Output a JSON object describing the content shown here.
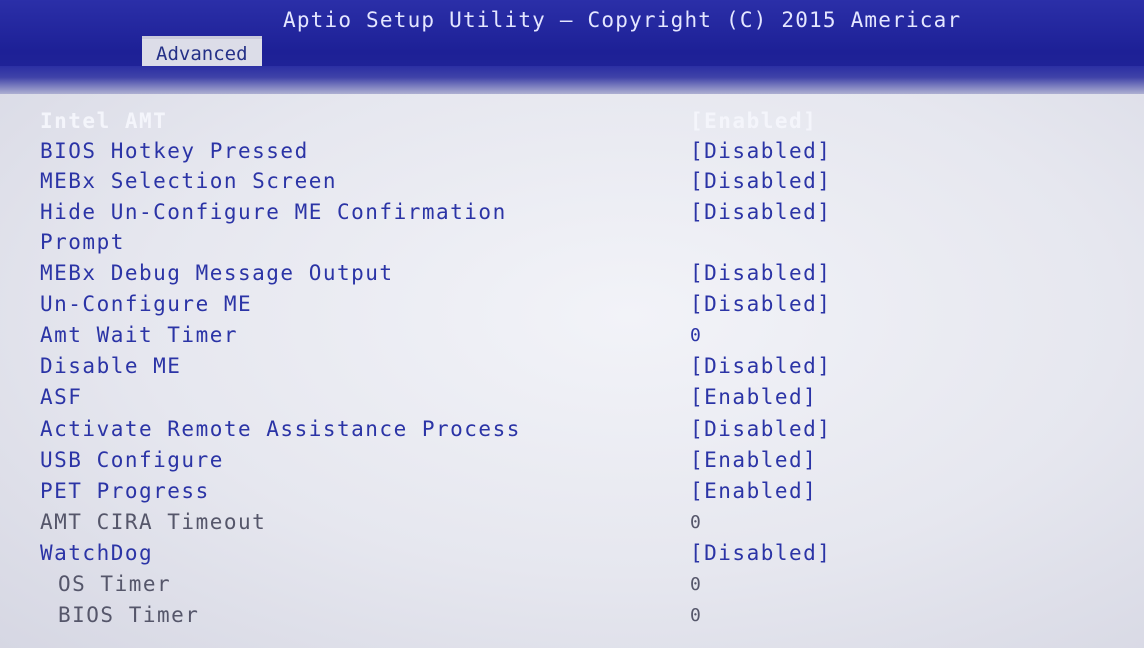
{
  "header": {
    "title": "Aptio Setup Utility – Copyright (C) 2015 Americar",
    "tab": "Advanced"
  },
  "colors": {
    "header_bg": "#1d2096",
    "panel_bg": "#e6e7ef",
    "active_text": "#2b34a6",
    "selected_text": "#f4f5fb",
    "inactive_text": "#55566a"
  },
  "settings": [
    {
      "label": "Intel AMT",
      "value": "[Enabled]"
    },
    {
      "label": "BIOS Hotkey Pressed",
      "value": "[Disabled]"
    },
    {
      "label": "MEBx Selection Screen",
      "value": "[Disabled]"
    },
    {
      "label": "Hide Un-Configure ME Confirmation",
      "value": "[Disabled]"
    },
    {
      "label": "Prompt",
      "value": ""
    },
    {
      "label": "MEBx Debug Message Output",
      "value": "[Disabled]"
    },
    {
      "label": "Un-Configure ME",
      "value": "[Disabled]"
    },
    {
      "label": "Amt Wait Timer",
      "value": "0"
    },
    {
      "label": "Disable ME",
      "value": "[Disabled]"
    },
    {
      "label": "ASF",
      "value": "[Enabled]"
    },
    {
      "label": "Activate Remote Assistance Process",
      "value": "[Disabled]"
    },
    {
      "label": "USB Configure",
      "value": "[Enabled]"
    },
    {
      "label": "PET Progress",
      "value": "[Enabled]"
    },
    {
      "label": "AMT CIRA Timeout",
      "value": "0"
    },
    {
      "label": "WatchDog",
      "value": "[Disabled]"
    },
    {
      "label": "OS Timer",
      "value": "0"
    },
    {
      "label": "BIOS Timer",
      "value": "0"
    }
  ]
}
